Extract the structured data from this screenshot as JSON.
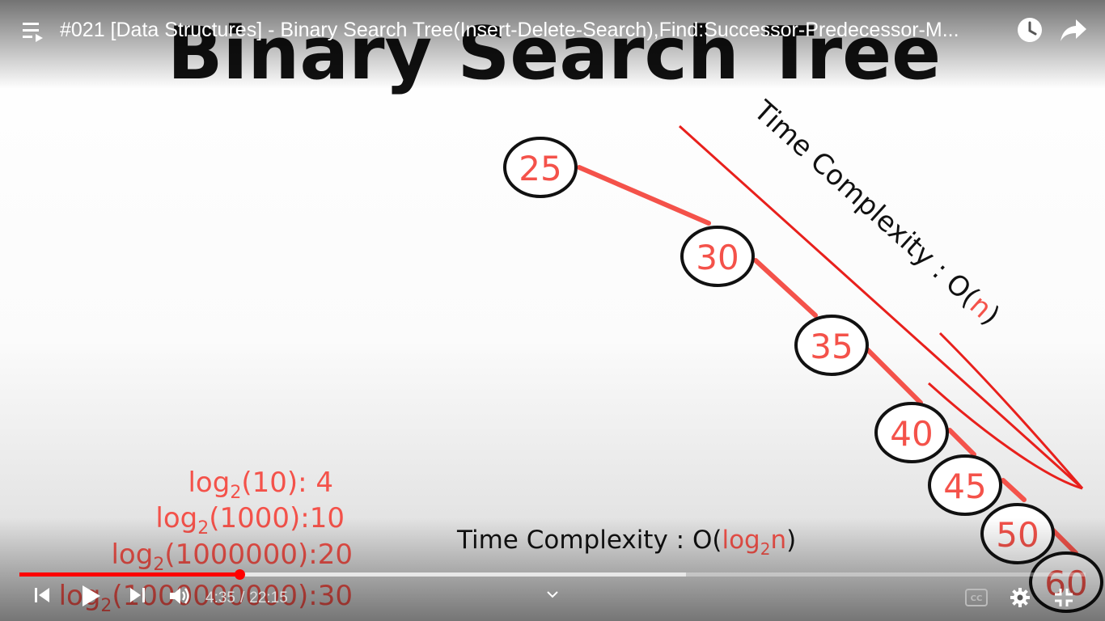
{
  "header": {
    "title": "#021 [Data Structures] - Binary Search Tree(Insert-Delete-Search),Find:Successor-Predecessor-M..."
  },
  "slide": {
    "heading": "Binary Search Tree",
    "nodes": [
      "25",
      "30",
      "35",
      "40",
      "45",
      "50",
      "60"
    ],
    "skewed_complexity": {
      "label": "Time Complexity : O(",
      "var": "n",
      "close": ")"
    },
    "balanced_complexity": {
      "label": "Time Complexity : O(",
      "fn": "log",
      "sub": "2",
      "var": "n",
      "close": ")"
    },
    "log_examples": [
      {
        "fn": "log",
        "sub": "2",
        "arg": "(10): 4"
      },
      {
        "fn": "log",
        "sub": "2",
        "arg": "(1000):10"
      },
      {
        "fn": "log",
        "sub": "2",
        "arg": "(1000000):20"
      },
      {
        "fn": "log",
        "sub": "2",
        "arg": "(1000000000):30"
      }
    ]
  },
  "player": {
    "current_time": "4:35",
    "separator": "/",
    "duration": "22:15",
    "progress_fraction": 0.206,
    "buffered_fraction": 0.625
  },
  "colors": {
    "accent_red": "#f4524a",
    "line_red": "#e8201c",
    "progress_red": "#ff0000"
  }
}
